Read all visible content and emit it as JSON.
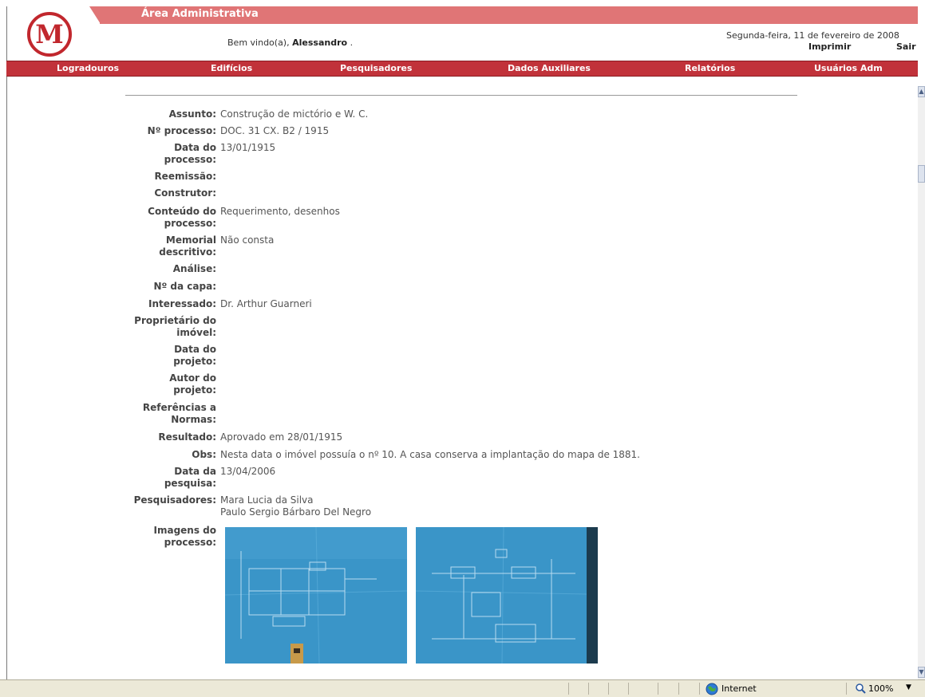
{
  "header": {
    "area_title": "Área Administrativa",
    "welcome_prefix": "Bem vindo(a),",
    "user_name": "Alessandro",
    "welcome_suffix": ".",
    "date": "Segunda-feira, 11 de fevereiro de 2008",
    "print_label": "Imprimir",
    "exit_label": "Sair",
    "logo_letter": "M"
  },
  "nav": {
    "logradouros": "Logradouros",
    "edificios": "Edifícios",
    "pesquisadores": "Pesquisadores",
    "dados_auxiliares": "Dados Auxiliares",
    "relatorios": "Relatórios",
    "usuarios_adm": "Usuários Adm"
  },
  "fields": {
    "assunto": {
      "label": "Assunto:",
      "value": "Construção de mictório e W. C."
    },
    "processo": {
      "label": "Nº processo:",
      "value": "DOC. 31 CX. B2 / 1915"
    },
    "data_processo": {
      "label1": "Data do",
      "label2": "processo:",
      "value": "13/01/1915"
    },
    "reemissao": {
      "label": "Reemissão:",
      "value": ""
    },
    "construtor": {
      "label": "Construtor:",
      "value": ""
    },
    "conteudo": {
      "label1": "Conteúdo do",
      "label2": "processo:",
      "value": "Requerimento, desenhos"
    },
    "memorial": {
      "label1": "Memorial",
      "label2": "descritivo:",
      "value": "Não consta"
    },
    "analise": {
      "label": "Análise:",
      "value": ""
    },
    "capa": {
      "label": "Nº da capa:",
      "value": ""
    },
    "interessado": {
      "label": "Interessado:",
      "value": "Dr. Arthur Guarneri"
    },
    "proprietario": {
      "label1": "Proprietário do",
      "label2": "imóvel:",
      "value": ""
    },
    "data_projeto": {
      "label1": "Data do",
      "label2": "projeto:",
      "value": ""
    },
    "autor_projeto": {
      "label1": "Autor do",
      "label2": "projeto:",
      "value": ""
    },
    "referencias": {
      "label1": "Referências a",
      "label2": "Normas:",
      "value": ""
    },
    "resultado": {
      "label": "Resultado:",
      "value": "Aprovado em 28/01/1915"
    },
    "obs": {
      "label": "Obs:",
      "value": "Nesta data o imóvel possuía o nº 10. A casa conserva a implantação do mapa de 1881."
    },
    "data_pesquisa": {
      "label1": "Data da",
      "label2": "pesquisa:",
      "value": "13/04/2006"
    },
    "pesquisadores": {
      "label": "Pesquisadores:",
      "value1": "Mara Lucia da Silva",
      "value2": "Paulo Sergio Bárbaro Del Negro"
    },
    "imagens": {
      "label1": "Imagens do",
      "label2": "processo:"
    }
  },
  "statusbar": {
    "zone": "Internet",
    "zoom": "100%",
    "zone_icon": "globe-icon",
    "zoom_icon": "magnifier-icon"
  },
  "colors": {
    "title_bar": "#e07576",
    "nav_bar": "#c1323a",
    "blueprint": "#3a95c8"
  }
}
